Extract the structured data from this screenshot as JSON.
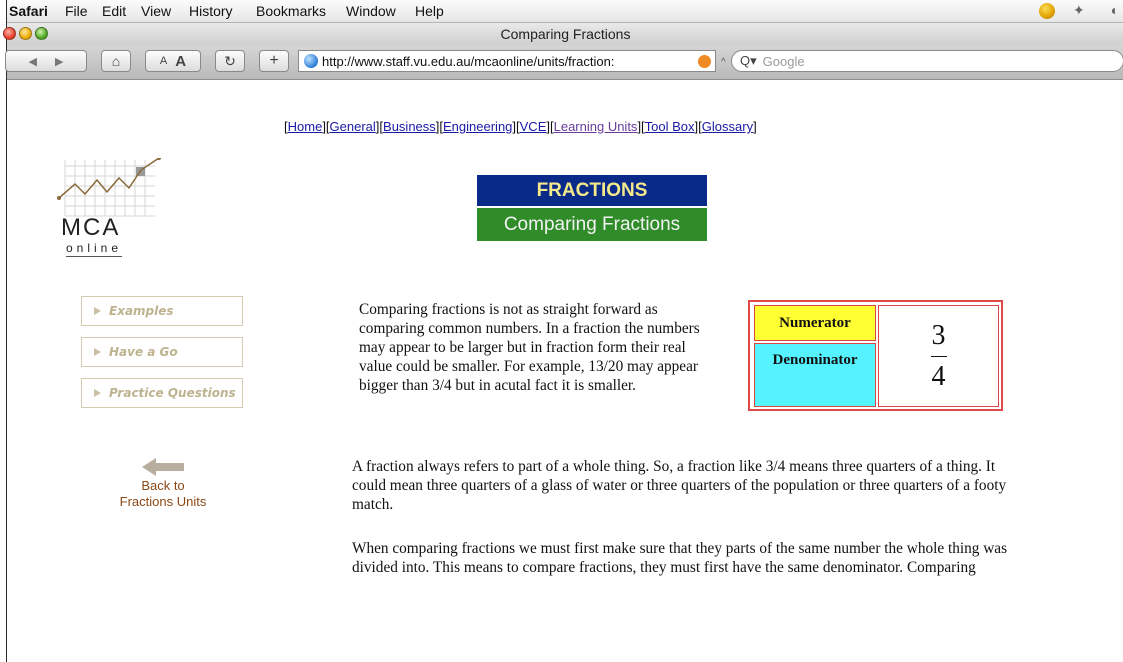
{
  "menubar": {
    "app": "Safari",
    "items": [
      "File",
      "Edit",
      "View",
      "History",
      "Bookmarks",
      "Window",
      "Help"
    ]
  },
  "window": {
    "title": "Comparing Fractions"
  },
  "toolbar": {
    "back_glyph": "◀",
    "forward_glyph": "▶",
    "home_glyph": "⌂",
    "text_small": "A",
    "text_large": "A",
    "reload_glyph": "↻",
    "add_glyph": "+",
    "url": "http://www.staff.vu.edu.au/mcaonline/units/fraction:",
    "search_placeholder": "Google",
    "search_glyph": "Q▾",
    "bookmark_caret": "^"
  },
  "topnav": {
    "links": [
      "Home",
      "General",
      "Business",
      "Engineering",
      "VCE",
      "Learning Units",
      "Tool Box",
      "Glossary"
    ]
  },
  "logo": {
    "name": "MCA",
    "sub": "online"
  },
  "heading": {
    "title": "FRACTIONS",
    "subtitle": "Comparing Fractions"
  },
  "sidebar": {
    "items": [
      {
        "label": "Examples"
      },
      {
        "label": "Have a Go"
      },
      {
        "label": "Practice Questions"
      }
    ],
    "back_line1": "Back to",
    "back_line2": "Fractions Units"
  },
  "content": {
    "intro": "Comparing fractions is not as straight forward as comparing common numbers. In a fraction the numbers may appear to be larger but in fraction form their real value could be smaller. For example, 13/20 may appear bigger than 3/4 but in acutal fact it is smaller.",
    "para2": "A fraction always refers to part of a whole thing. So, a fraction like 3/4 means three quarters of a thing. It could mean three quarters of a glass of water or three quarters of the population or three quarters of a footy match.",
    "para3": "When comparing fractions we must first make sure that they parts of the same number the whole thing was divided into. This means to compare fractions, they must first have the same denominator. Comparing"
  },
  "fraction": {
    "numerator_label": "Numerator",
    "denominator_label": "Denominator",
    "numerator": "3",
    "denominator": "4"
  },
  "colors": {
    "heading_bg": "#0a2a8a",
    "heading_text": "#f3e88a",
    "subheading_bg": "#2f8c28",
    "numerator_bg": "#ffff33",
    "denominator_bg": "#55f3ff",
    "table_border": "#e04a4a",
    "link": "#1a1aa6",
    "visited_link": "#6a3c9c",
    "back_text": "#8b4a17"
  }
}
